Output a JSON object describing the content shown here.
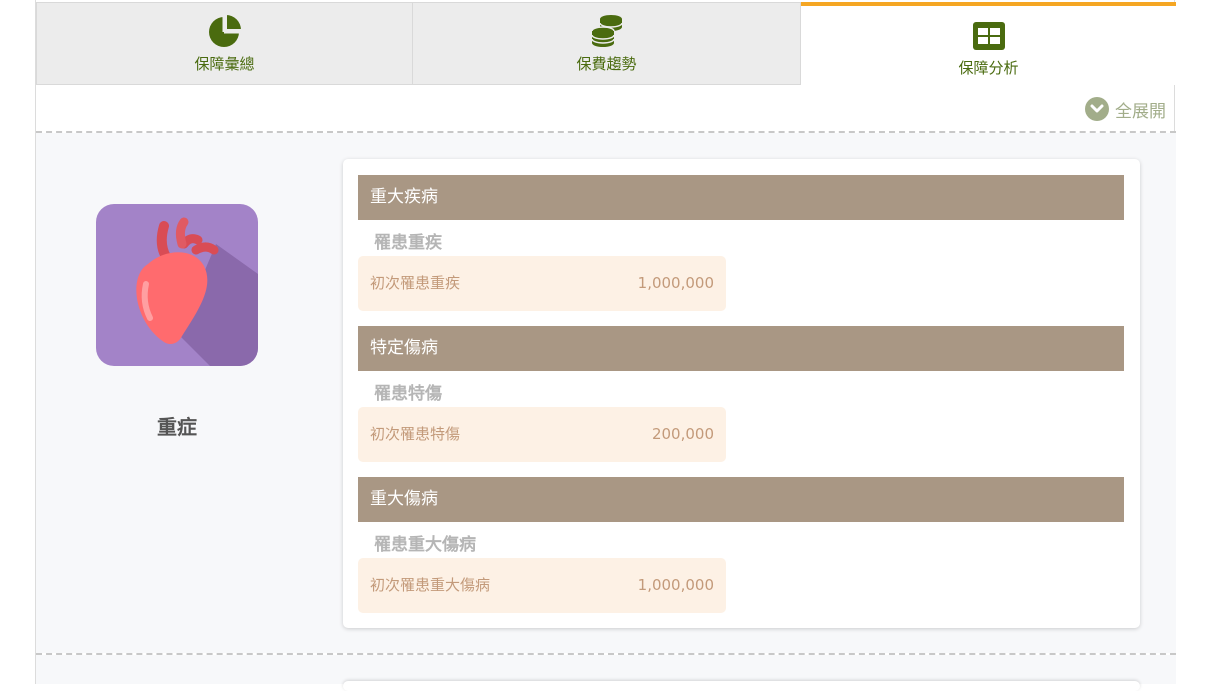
{
  "tabs": [
    {
      "label": "保障彙總",
      "icon": "pie-chart-icon"
    },
    {
      "label": "保費趨勢",
      "icon": "coins-stack-icon"
    },
    {
      "label": "保障分析",
      "icon": "table-grid-icon",
      "active": true
    }
  ],
  "toolbar": {
    "expand_all_label": "全展開",
    "icon": "chevron-down-circle-icon"
  },
  "category": {
    "label": "重症",
    "icon": "heart-icon"
  },
  "groups": [
    {
      "title": "重大疾病",
      "subtitle": "罹患重疾",
      "item": {
        "name": "初次罹患重疾",
        "value": "1,000,000"
      }
    },
    {
      "title": "特定傷病",
      "subtitle": "罹患特傷",
      "item": {
        "name": "初次罹患特傷",
        "value": "200,000"
      }
    },
    {
      "title": "重大傷病",
      "subtitle": "罹患重大傷病",
      "item": {
        "name": "初次罹患重大傷病",
        "value": "1,000,000"
      }
    }
  ],
  "colors": {
    "accent": "#f5a623",
    "tab_icon": "#4a6b0f",
    "group_header": "#a99784",
    "row_bg": "#fdf1e5",
    "row_text": "#c39a7a"
  }
}
